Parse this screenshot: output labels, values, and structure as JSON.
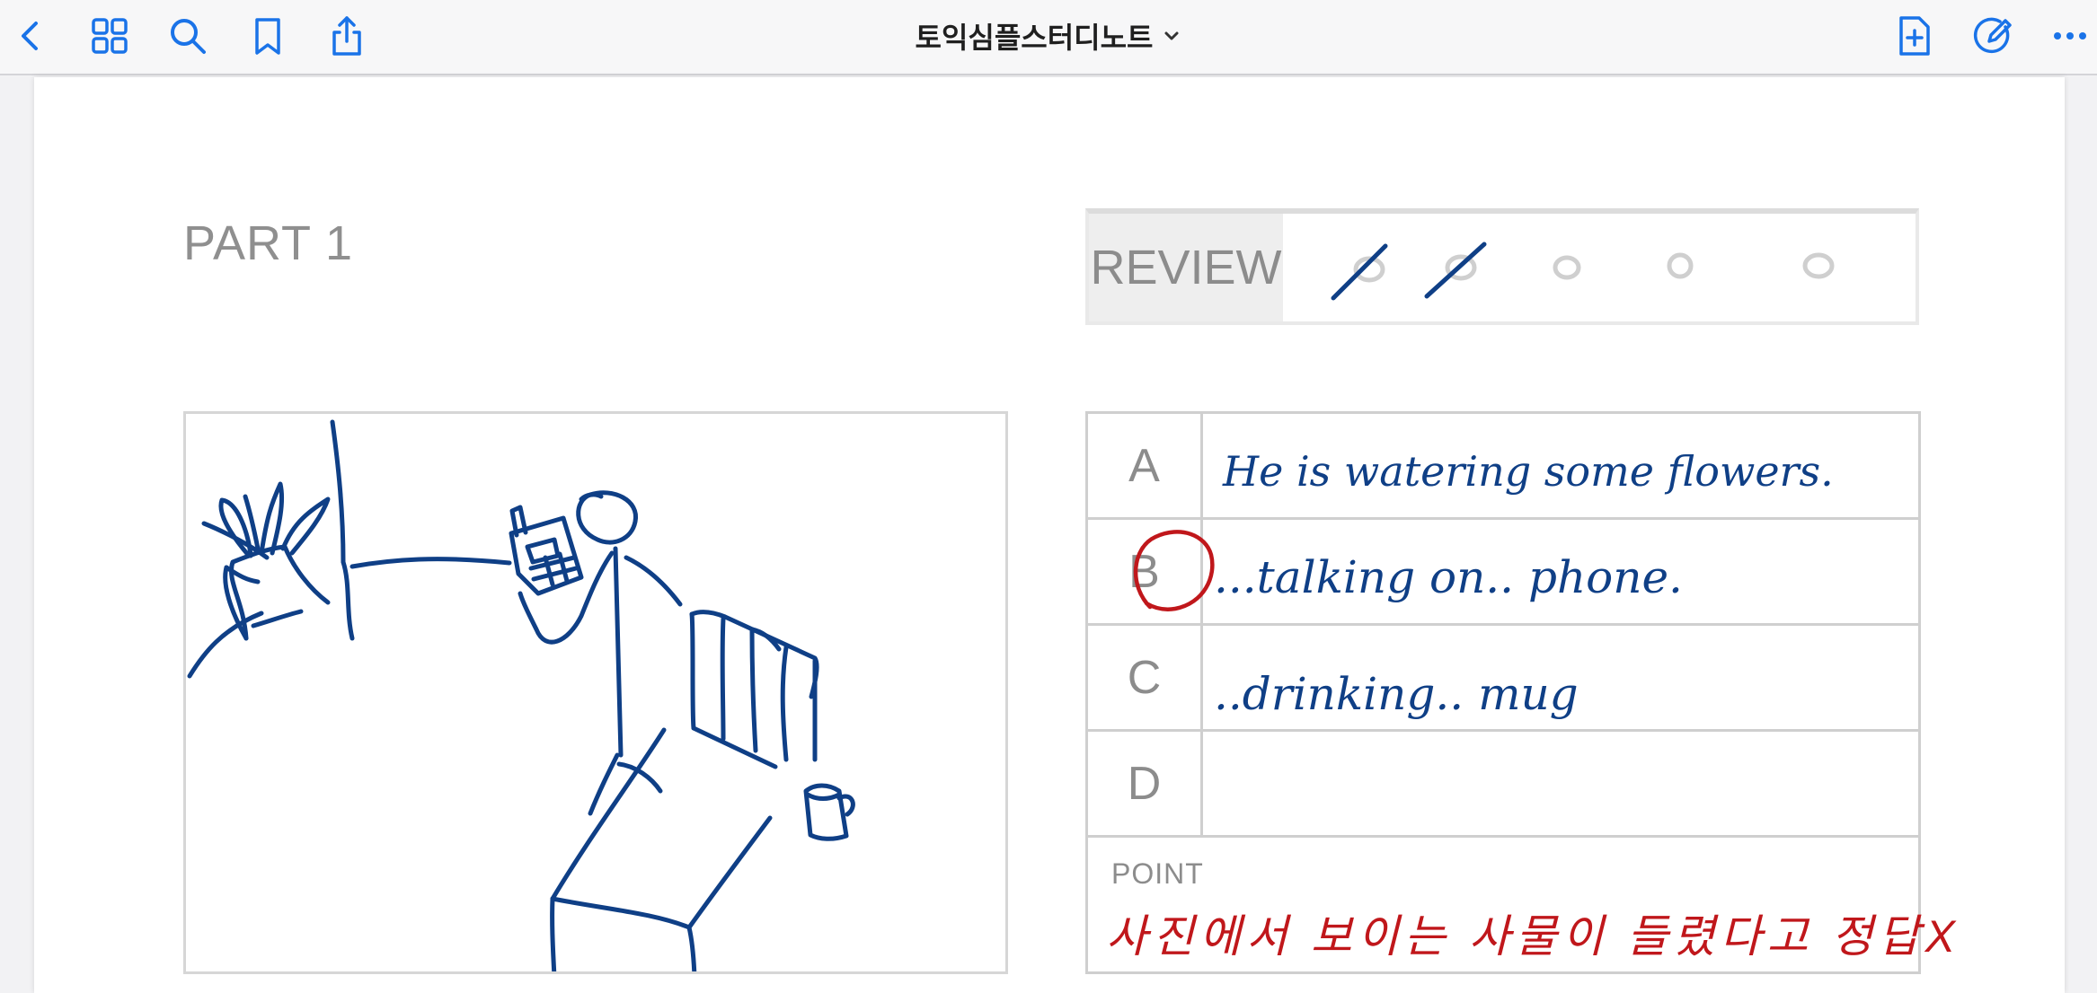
{
  "toolbar": {
    "left_icons": [
      "chevron-left-icon",
      "grid-icon",
      "search-icon",
      "bookmark-icon",
      "share-icon"
    ],
    "title": "토익심플스터디노트",
    "right_icons": [
      "add-page-icon",
      "pencil-circle-icon",
      "more-icon"
    ],
    "accent_color": "#1a73e8"
  },
  "page": {
    "part_title": "PART 1",
    "review": {
      "label": "REVIEW",
      "circles": [
        {
          "state": "checked"
        },
        {
          "state": "checked"
        },
        {
          "state": "empty"
        },
        {
          "state": "empty"
        },
        {
          "state": "empty"
        }
      ]
    },
    "answers": [
      {
        "letter": "A",
        "note": "He is watering some flowers.",
        "selected": false
      },
      {
        "letter": "B",
        "note": "...talking on.. phone.",
        "selected": true
      },
      {
        "letter": "C",
        "note": "..drinking.. mug",
        "selected": false
      },
      {
        "letter": "D",
        "note": "",
        "selected": false
      }
    ],
    "point": {
      "label": "POINT",
      "note": "사진에서 보이는 사물이 들렸다고 정답X"
    },
    "ink_color": "#0f3f86",
    "annotation_color": "#c0171b"
  }
}
